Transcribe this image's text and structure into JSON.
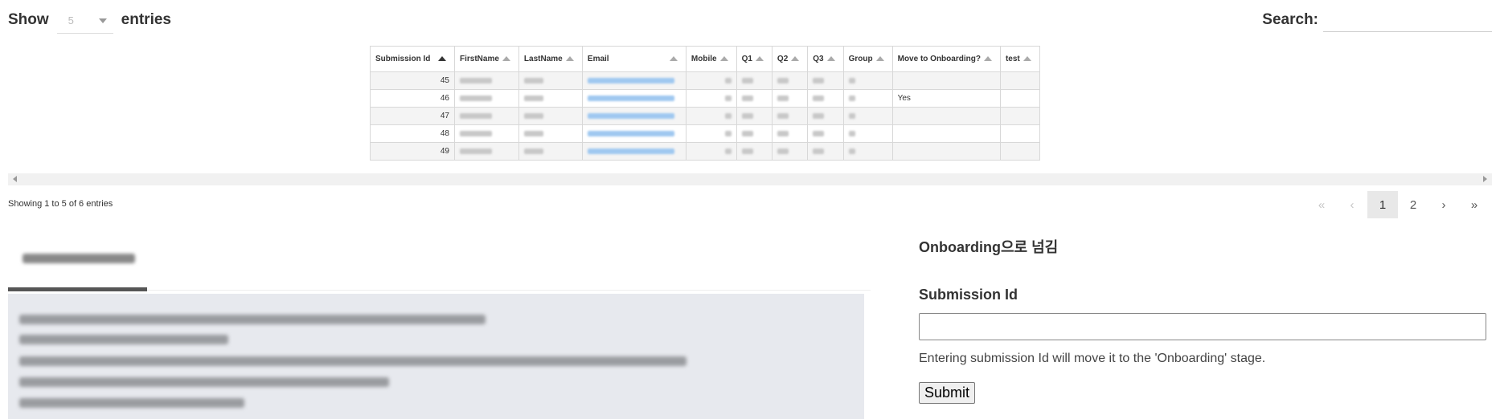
{
  "length_menu": {
    "show_label": "Show",
    "selected": "5",
    "entries_label": "entries"
  },
  "search": {
    "label": "Search:",
    "placeholder": "",
    "value": ""
  },
  "table": {
    "columns": [
      "Submission Id",
      "FirstName",
      "LastName",
      "Email",
      "Mobile",
      "Q1",
      "Q2",
      "Q3",
      "Group",
      "Move to Onboarding?",
      "test"
    ],
    "rows": [
      {
        "id": "45",
        "move": "",
        "test": ""
      },
      {
        "id": "46",
        "move": "Yes",
        "test": ""
      },
      {
        "id": "47",
        "move": "",
        "test": ""
      },
      {
        "id": "48",
        "move": "",
        "test": ""
      },
      {
        "id": "49",
        "move": "",
        "test": ""
      }
    ]
  },
  "info": "Showing 1 to 5 of 6 entries",
  "pagination": {
    "first": "«",
    "prev": "‹",
    "pages": [
      "1",
      "2"
    ],
    "current": "1",
    "next": "›",
    "last": "»"
  },
  "form": {
    "heading": "Onboarding으로 넘김",
    "field_label": "Submission Id",
    "field_value": "",
    "help": "Entering submission Id will move it to the 'Onboarding' stage.",
    "submit": "Submit"
  },
  "icons": {
    "sort": "sort-asc-icon",
    "scroll_left": "arrow-left-icon",
    "scroll_right": "arrow-right-icon",
    "dropdown": "chevron-down-icon"
  }
}
